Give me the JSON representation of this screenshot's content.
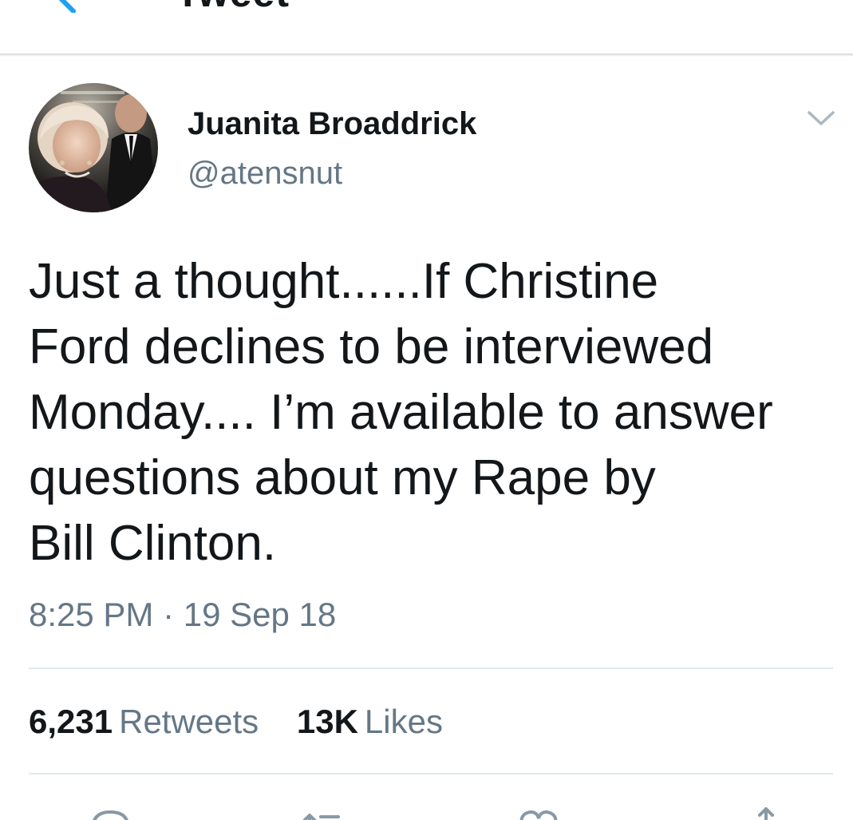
{
  "header": {
    "title": "Tweet",
    "back_icon": "chevron-left-icon"
  },
  "author": {
    "name": "Juanita Broaddrick",
    "handle": "@atensnut"
  },
  "tweet": {
    "lines": [
      "Just a thought......If Christine",
      "Ford declines to be interviewed",
      "Monday.... I’m available to answer",
      "questions about my Rape by",
      "Bill Clinton."
    ],
    "timestamp": "8:25 PM · 19 Sep 18"
  },
  "stats": {
    "retweets_count": "6,231",
    "retweets_label": "Retweets",
    "likes_count": "13K",
    "likes_label": "Likes"
  },
  "actions": [
    "reply-icon",
    "retweet-icon",
    "like-icon",
    "share-icon"
  ],
  "colors": {
    "accent": "#1da1f2",
    "text_primary": "#14171a",
    "text_secondary": "#657786",
    "divider": "#e1e8ed"
  }
}
